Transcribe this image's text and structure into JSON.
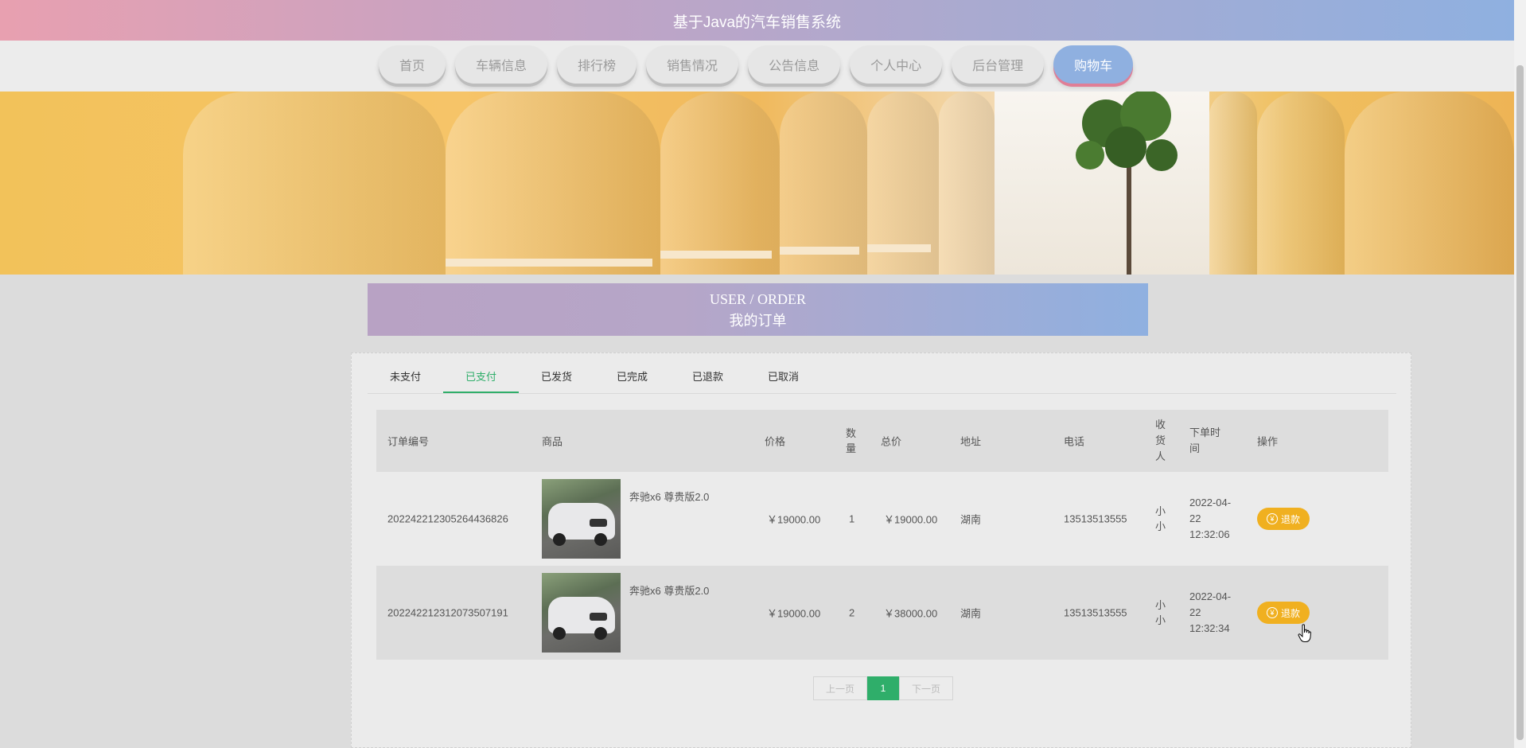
{
  "header": {
    "title": "基于Java的汽车销售系统"
  },
  "nav": {
    "items": [
      {
        "label": "首页"
      },
      {
        "label": "车辆信息"
      },
      {
        "label": "排行榜"
      },
      {
        "label": "销售情况"
      },
      {
        "label": "公告信息"
      },
      {
        "label": "个人中心"
      },
      {
        "label": "后台管理"
      },
      {
        "label": "购物车"
      }
    ],
    "active_label": "购物车"
  },
  "section": {
    "en_title": "USER / ORDER",
    "cn_title": "我的订单"
  },
  "tabs": {
    "items": [
      {
        "label": "未支付"
      },
      {
        "label": "已支付"
      },
      {
        "label": "已发货"
      },
      {
        "label": "已完成"
      },
      {
        "label": "已退款"
      },
      {
        "label": "已取消"
      }
    ],
    "active_label": "已支付"
  },
  "table": {
    "headers": {
      "order_no": "订单编号",
      "product": "商品",
      "price": "价格",
      "qty": "数量",
      "total": "总价",
      "address": "地址",
      "phone": "电话",
      "receiver": "收货人",
      "time": "下单时间",
      "action": "操作"
    },
    "rows": [
      {
        "order_no": "20224221230526443682 6",
        "order_no_display": "202242212305264436826",
        "product_name": "奔驰x6 尊贵版2.0",
        "price": "￥19000.00",
        "qty": "1",
        "total": "￥19000.00",
        "address": "湖南",
        "phone": "13513513555",
        "receiver": "小小",
        "time": "2022-04-22 12:32:06",
        "action_label": "退款"
      },
      {
        "order_no": "202242212312073507191",
        "order_no_display": "202242212312073507191",
        "product_name": "奔驰x6 尊贵版2.0",
        "price": "￥19000.00",
        "qty": "2",
        "total": "￥38000.00",
        "address": "湖南",
        "phone": "13513513555",
        "receiver": "小小",
        "time": "2022-04-22 12:32:34",
        "action_label": "退款"
      }
    ]
  },
  "pager": {
    "prev": "上一页",
    "current": "1",
    "next": "下一页"
  },
  "colors": {
    "accent_green": "#2fae6a",
    "refund_orange": "#f0b020",
    "nav_active": "#8fb0e0"
  }
}
